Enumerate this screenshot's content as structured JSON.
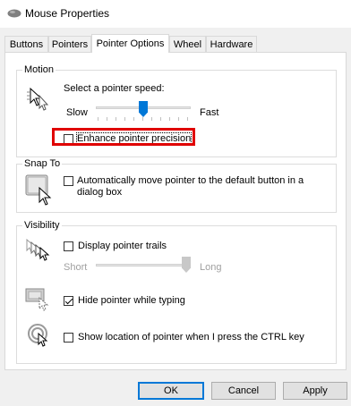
{
  "window": {
    "title": "Mouse Properties",
    "app_icon": "mouse-icon"
  },
  "tabs": [
    {
      "label": "Buttons",
      "active": false
    },
    {
      "label": "Pointers",
      "active": false
    },
    {
      "label": "Pointer Options",
      "active": true
    },
    {
      "label": "Wheel",
      "active": false
    },
    {
      "label": "Hardware",
      "active": false
    }
  ],
  "motion": {
    "group_label": "Motion",
    "icon": "pointer-speed-icon",
    "speed_label": "Select a pointer speed:",
    "slow_label": "Slow",
    "fast_label": "Fast",
    "speed_level": 0.5,
    "precision_label": "Enhance pointer precision",
    "precision_checked": false
  },
  "snap_to": {
    "group_label": "Snap To",
    "icon": "snap-to-icon",
    "auto_label_line1": "Automatically move pointer to the default button in a",
    "auto_label_line2": "dialog box",
    "auto_checked": false
  },
  "visibility": {
    "group_label": "Visibility",
    "trails_icon": "pointer-trails-icon",
    "trails_label": "Display pointer trails",
    "trails_checked": false,
    "short_label": "Short",
    "long_label": "Long",
    "trail_length_level": 1.0,
    "hide_icon": "hide-pointer-icon",
    "hide_label": "Hide pointer while typing",
    "hide_checked": true,
    "ctrl_icon": "show-location-icon",
    "ctrl_label": "Show location of pointer when I press the CTRL key",
    "ctrl_checked": false
  },
  "buttons": {
    "ok": "OK",
    "cancel": "Cancel",
    "apply": "Apply"
  },
  "colors": {
    "accent": "#0078d7",
    "highlight": "#e00000"
  }
}
